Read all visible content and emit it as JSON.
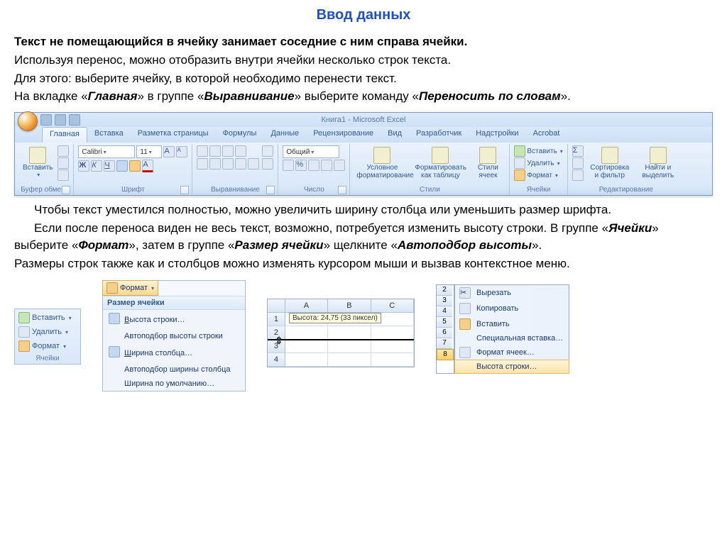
{
  "title": "Ввод данных",
  "p1": "Текст не помещающийся в ячейку занимает соседние с ним справа ячейки.",
  "p2": "Используя перенос, можно отобразить внутри ячейки несколько строк текста.",
  "p3": "Для этого: выберите ячейку, в которой необходимо перенести текст.",
  "p4a": "На вкладке «",
  "p4b": "Главная",
  "p4c": "» в группе «",
  "p4d": "Выравнивание",
  "p4e": "» выберите команду «",
  "p4f": "Переносить по словам",
  "p4g": "».",
  "ribbon": {
    "window_title": "Книга1 - Microsoft Excel",
    "tabs": [
      "Главная",
      "Вставка",
      "Разметка страницы",
      "Формулы",
      "Данные",
      "Рецензирование",
      "Вид",
      "Разработчик",
      "Надстройки",
      "Acrobat"
    ],
    "clipboard": {
      "paste": "Вставить",
      "caption": "Буфер обмена"
    },
    "font": {
      "name": "Calibri",
      "size": "11",
      "bold": "Ж",
      "italic": "К",
      "underline": "Ч",
      "caption": "Шрифт"
    },
    "alignment": {
      "caption": "Выравнивание"
    },
    "number": {
      "format": "Общий",
      "caption": "Число"
    },
    "styles": {
      "cond": "Условное форматирование",
      "as_table": "Форматировать как таблицу",
      "cell_styles": "Стили ячеек",
      "caption": "Стили"
    },
    "cells": {
      "insert": "Вставить",
      "delete": "Удалить",
      "format": "Формат",
      "caption": "Ячейки"
    },
    "editing": {
      "sort": "Сортировка и фильтр",
      "find": "Найти и выделить",
      "caption": "Редактирование"
    }
  },
  "p5": "Чтобы текст уместился полностью, можно увеличить ширину столбца или уменьшить размер шрифта.",
  "p6a": "Если после переноса виден не весь текст, возможно, потребуется изменить высоту строки. В группе «",
  "p6b": "Ячейки",
  "p6c": "» выберите «",
  "p6d": "Формат",
  "p6e": "», затем в группе «",
  "p6f": "Размер ячейки",
  "p6g": "» щелкните «",
  "p6h": "Автоподбор высоты",
  "p6i": "».",
  "p7": "Размеры строк также как и столбцов можно изменять курсором мыши и вызвав контекстное меню.",
  "cells_panel": {
    "insert": "Вставить",
    "delete": "Удалить",
    "format": "Формат",
    "caption": "Ячейки"
  },
  "format_menu": {
    "button": "Формат",
    "header": "Размер ячейки",
    "items": [
      "Высота строки…",
      "Автоподбор высоты строки",
      "Ширина столбца…",
      "Автоподбор ширины столбца",
      "Ширина по умолчанию…"
    ]
  },
  "sheet": {
    "cols": [
      "A",
      "B",
      "C"
    ],
    "rows": [
      "1",
      "2",
      "3",
      "4"
    ],
    "tooltip": "Высота: 24,75 (33 пиксел)"
  },
  "context_menu": {
    "rows": [
      "2",
      "3",
      "4",
      "5",
      "6",
      "7",
      "8"
    ],
    "items": [
      "Вырезать",
      "Копировать",
      "Вставить",
      "Специальная вставка…",
      "Формат ячеек…",
      "Высота строки…"
    ]
  }
}
